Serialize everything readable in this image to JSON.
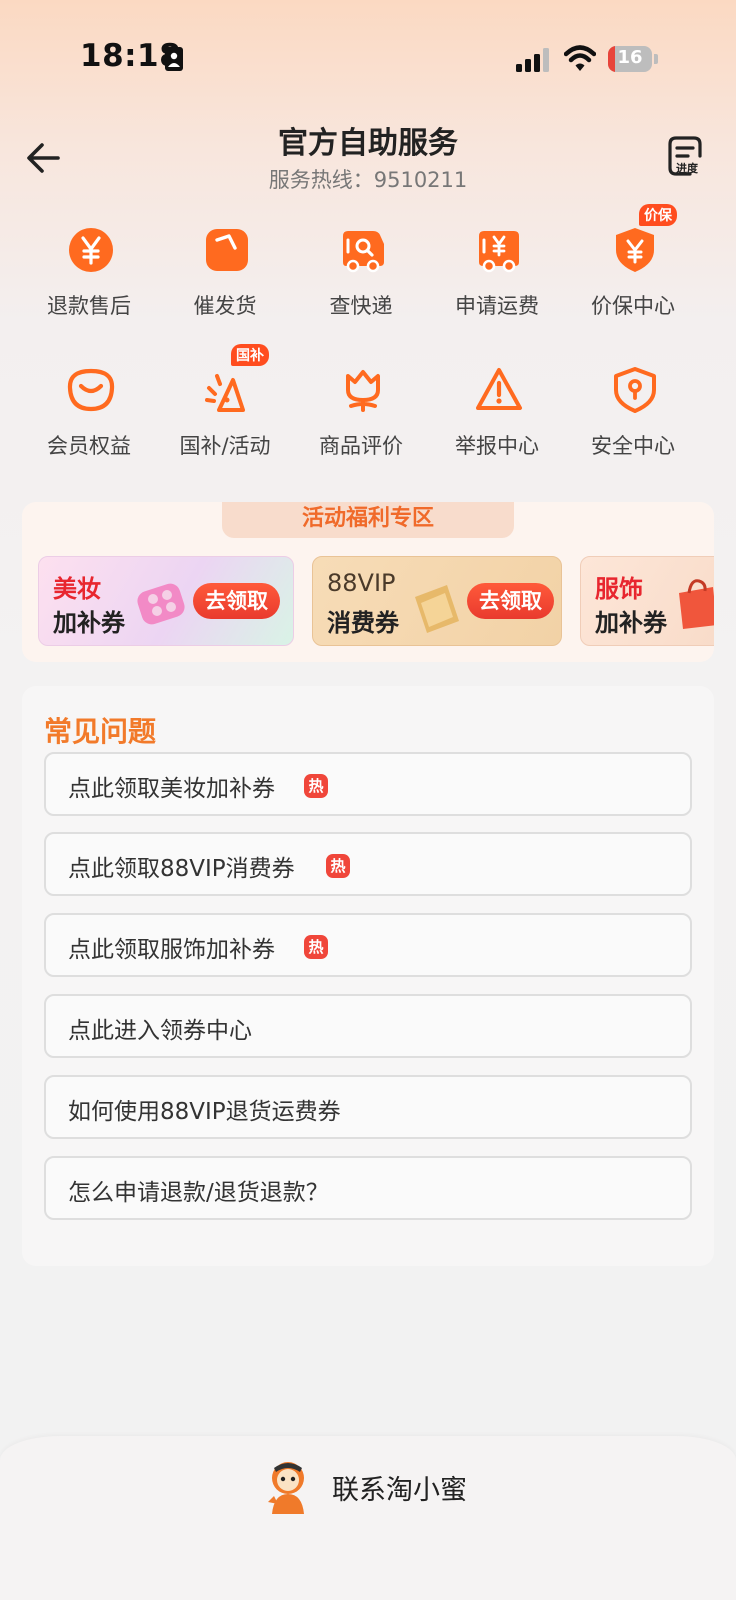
{
  "status_bar": {
    "time": "18:18",
    "battery_level": "16",
    "battery_fraction": 0.16
  },
  "header": {
    "title": "官方自助服务",
    "hotline": "服务热线：9510211",
    "progress_label": "进度"
  },
  "services": [
    {
      "label": "退款售后",
      "icon": "yen-circle-icon"
    },
    {
      "label": "催发货",
      "icon": "package-icon"
    },
    {
      "label": "查快递",
      "icon": "delivery-truck-search-icon"
    },
    {
      "label": "申请运费",
      "icon": "freight-truck-yen-icon"
    },
    {
      "label": "价保中心",
      "icon": "price-shield-icon",
      "badge": "价保"
    },
    {
      "label": "会员权益",
      "icon": "member-smile-icon"
    },
    {
      "label": "国补/活动",
      "icon": "party-popper-icon",
      "badge": "国补"
    },
    {
      "label": "商品评价",
      "icon": "tulip-icon"
    },
    {
      "label": "举报中心",
      "icon": "warning-triangle-icon"
    },
    {
      "label": "安全中心",
      "icon": "security-shield-icon"
    }
  ],
  "promo": {
    "title": "活动福利专区",
    "coupons": [
      {
        "top": "美妆",
        "bottom": "加补券",
        "button": "去领取",
        "top_color": "#e8262f"
      },
      {
        "top": "88VIP",
        "bottom": "消费券",
        "button": "去领取",
        "top_color": "#4a3a2a"
      },
      {
        "top": "服饰",
        "bottom": "加补券",
        "top_color": "#e8262f"
      }
    ]
  },
  "faq": {
    "title": "常见问题",
    "items": [
      {
        "text": "点此领取美妆加补券",
        "hot": "热"
      },
      {
        "text": "点此领取88VIP消费券",
        "hot": "热"
      },
      {
        "text": "点此领取服饰加补券",
        "hot": "热"
      },
      {
        "text": "点此进入领券中心"
      },
      {
        "text": "如何使用88VIP退货运费券"
      },
      {
        "text": "怎么申请退款/退货退款？"
      }
    ]
  },
  "footer": {
    "contact_label": "联系淘小蜜"
  },
  "colors": {
    "accent": "#ff6a1f",
    "faq_title": "#f27a2a",
    "hot_badge": "#f0463a"
  }
}
